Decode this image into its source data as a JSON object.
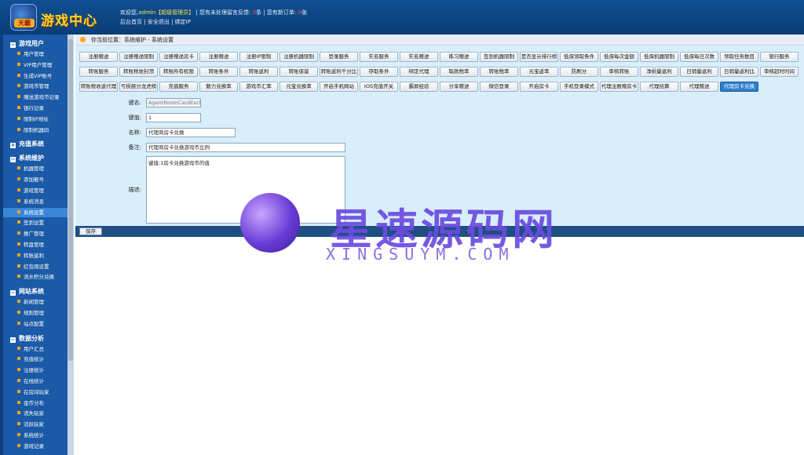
{
  "header": {
    "logo_badge": "天霸",
    "title": "游戏中心",
    "welcome_prefix": "欢迎您,",
    "username": "admin",
    "role": "【超级管理员】",
    "sep": "|",
    "pending_msg_prefix": "您有未处理留言反馈:",
    "pending_msg_count": "0",
    "pending_msg_unit": "条",
    "new_orders_prefix": "您有新订单:",
    "new_orders_count": "0",
    "new_orders_unit": "张",
    "link_home": "后台首页",
    "link_logout": "安全退出",
    "link_bindip": "绑定IP"
  },
  "sidebar": {
    "groups": [
      {
        "label": "游戏用户",
        "items": [
          "用户管理",
          "VIP用户管理",
          "生成VIP账号",
          "游戏币管理",
          "赠送游戏币记录",
          "银行记录",
          "限制IP地址",
          "限制机器码"
        ]
      },
      {
        "label": "充值系统",
        "items": []
      },
      {
        "label": "系统维护",
        "items": [
          "机器管理",
          "添加靓号",
          "游戏管理",
          "系统消息",
          "系统设置",
          "签到设置",
          "推广管理",
          "转盘管理",
          "转账返利",
          "红包雨设置",
          "流水积分兑换"
        ]
      },
      {
        "label": "网站系统",
        "items": [
          "新闻管理",
          "规则管理",
          "站点配置"
        ]
      },
      {
        "label": "数据分析",
        "items": [
          "用户汇总",
          "充值统计",
          "注册统计",
          "在线统计",
          "在房间玩家",
          "金币分布",
          "流失玩家",
          "活跃玩家",
          "系统统计",
          "游戏记录"
        ]
      }
    ],
    "active": "系统设置"
  },
  "breadcrumb": "你当前位置：系统维护 - 系统设置",
  "tabs_row1": [
    "注册赠送",
    "注册赠送限制",
    "注册赠送房卡",
    "注册赠送",
    "注册IP限制",
    "注册机器限制",
    "登录服务",
    "实名服务",
    "实名赠送",
    "练习赠送",
    "签到机器限制",
    "是否显示排行榜",
    "低保领取条件",
    "低保每次金额",
    "低保机器限制",
    "低保每日次数",
    "领取任务数目",
    "银行服务"
  ],
  "tabs_row2": [
    "转账服务",
    "转账税收封顶",
    "转账所有权限",
    "转账条件",
    "转账返利",
    "转账保留",
    "转账返利千分比",
    "存取条件",
    "绑定代理",
    "取款税率",
    "转账税率",
    "元宝返率",
    "防刷分",
    "审核转账",
    "净损量返利",
    "日销量返利",
    "日销量返利比",
    "审核超时时间"
  ],
  "tabs_row3": [
    "转账税收返代理",
    "亏损额分龙虎榜",
    "充值服务",
    "魅力兑换率",
    "游戏币汇率",
    "元宝兑换率",
    "开启手机网站",
    "IOS充值开关",
    "霸屏经验",
    "分享赠送",
    "微信登录",
    "开启房卡",
    "手机登录模式",
    "代理注册赠房卡",
    "代理结算",
    "代理赠送",
    "代理房卡兑换"
  ],
  "selected_tab": "代理房卡兑换",
  "form": {
    "key_label": "键名:",
    "key_value": "AgentRoomCardExchRat",
    "value_label": "键值:",
    "value_value": "1",
    "name_label": "名称:",
    "name_value": "代理商房卡兑换",
    "note_label": "备注:",
    "note_value": "代理商房卡兑换游戏币比例",
    "desc_label": "描述:",
    "desc_value": "键值:1房卡兑换游戏币的值"
  },
  "save_label": "保存",
  "watermark": {
    "cn": "星速源码网",
    "en": "XINGSUYM.COM"
  },
  "colors": {
    "header": "#0f4f92",
    "sidebar": "#1a5aa6",
    "panel": "#d9eefb",
    "selected_tab": "#2f7fcf",
    "title": "#ffd52a"
  }
}
